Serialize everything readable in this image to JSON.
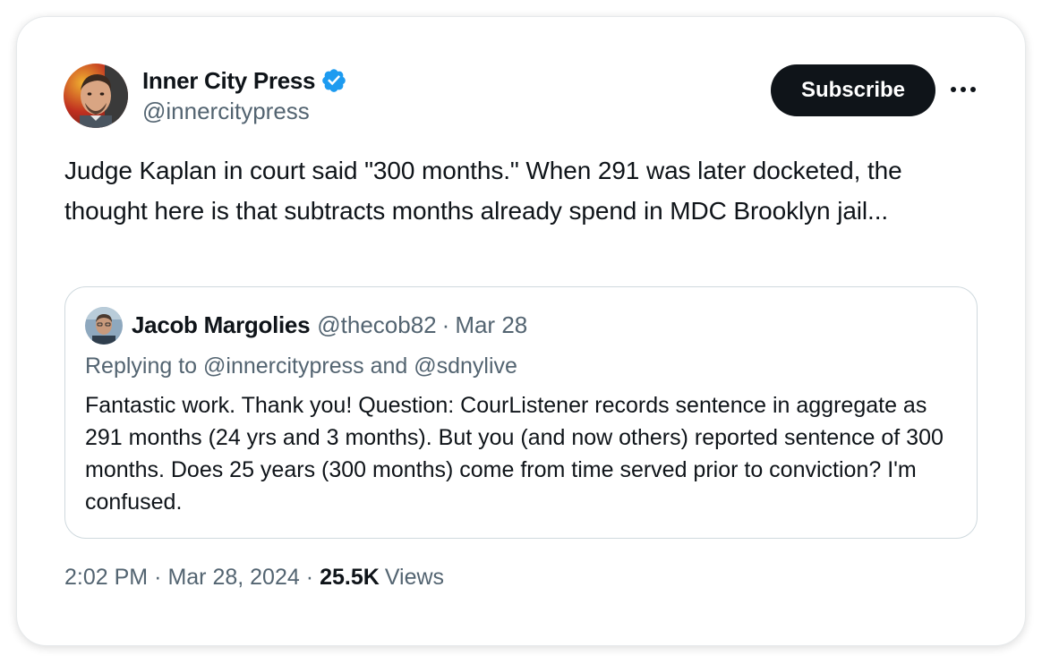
{
  "author": {
    "name": "Inner City Press",
    "handle": "@innercitypress",
    "verified_color": "#1d9bf0"
  },
  "actions": {
    "subscribe_label": "Subscribe",
    "more_icon": "more-horizontal-icon"
  },
  "tweet": {
    "text": "Judge Kaplan in court said \"300 months.\" When 291 was later docketed, the thought here is that subtracts months already spend in MDC Brooklyn jail..."
  },
  "quote": {
    "name": "Jacob Margolies",
    "handle": "@thecob82",
    "separator": "·",
    "date": "Mar 28",
    "replying": "Replying to @innercitypress and @sdnylive",
    "text": "Fantastic work. Thank you! Question: CourListener records sentence in aggregate as 291 months (24 yrs and 3 months). But you (and now others) reported sentence of 300 months. Does 25 years (300 months) come from time served prior to conviction? I'm confused."
  },
  "meta": {
    "time": "2:02 PM",
    "separator": "·",
    "date": "Mar 28, 2024",
    "views_count": "25.5K",
    "views_label": "Views"
  },
  "colors": {
    "text_primary": "#0f1419",
    "text_secondary": "#536471",
    "border": "#cfd9de",
    "button_bg": "#0f1419"
  }
}
